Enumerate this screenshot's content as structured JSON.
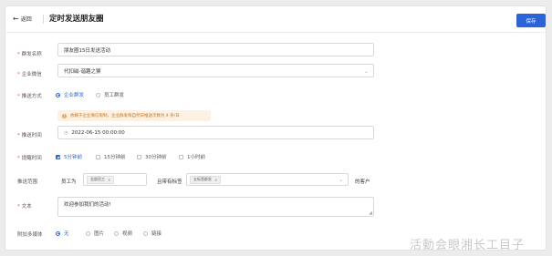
{
  "header": {
    "back_label": "返回",
    "title": "定时发送朋友圈",
    "save_label": "保存"
  },
  "form": {
    "name": {
      "label": "群发名称",
      "value": "朋友圈15日发送活动"
    },
    "wecom": {
      "label": "企业微信",
      "value": "代扣磁-谐趣之猴"
    },
    "push_mode": {
      "label": "推送方式",
      "options": [
        "企业群发",
        "员工群发"
      ],
      "tip": "依赖于企业微信限制，企业群发每自然日推送次数为 4 条/日"
    },
    "push_time": {
      "label": "推送时间",
      "value": "2022-06-15 00:00:00"
    },
    "remind": {
      "label": "提醒时间",
      "options": [
        "5分钟前",
        "15分钟前",
        "30分钟前",
        "1小时前"
      ]
    },
    "scope": {
      "label": "推送范围",
      "employee_label": "员工为",
      "employee_tag": "全部员工",
      "tag_label": "且带有标签",
      "customer_tag": "五标签群发",
      "suffix": "的客户"
    },
    "text": {
      "label": "文本",
      "value": "欢迎参加我们的活动!"
    },
    "media": {
      "label": "附加多媒体",
      "options": [
        "无",
        "图片",
        "视频",
        "链接"
      ]
    }
  },
  "watermark": "活動会眼湘长工目子",
  "colors": {
    "primary": "#2a64d8",
    "required": "#e34d59",
    "warning": "#f2a03d"
  }
}
